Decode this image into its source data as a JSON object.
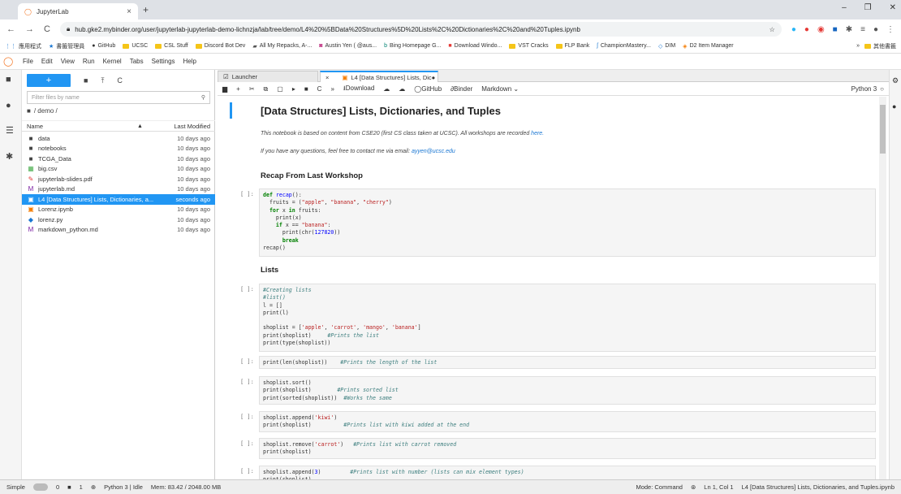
{
  "browser": {
    "tab_title": "JupyterLab",
    "url": "hub.gke2.mybinder.org/user/jupyterlab-jupyterlab-demo-lichnzja/lab/tree/demo/L4%20%5BData%20Structures%5D%20Lists%2C%20Dictionaries%2C%20and%20Tuples.ipynb",
    "bookmarks": [
      "應用程式",
      "書籤管理員",
      "GitHub",
      "UCSC",
      "CSL Stuff",
      "Discord Bot Dev",
      "All My Repacks, A-...",
      "Austin Yen ( @aus...",
      "Bing Homepage G...",
      "Download Windo...",
      "VST Cracks",
      "FLP Bank",
      "ChampionMastery...",
      "DIM",
      "D2 Item Manager"
    ],
    "bookmarks_other": "其他書籤"
  },
  "menu": [
    "File",
    "Edit",
    "View",
    "Run",
    "Kernel",
    "Tabs",
    "Settings",
    "Help"
  ],
  "filebrowser": {
    "filter_placeholder": "Filter files by name",
    "breadcrumb": "/ demo /",
    "col_name": "Name",
    "col_modified": "Last Modified",
    "files": [
      {
        "icon": "folder-icon",
        "glyph": "■",
        "name": "data",
        "modified": "10 days ago",
        "color": "#444"
      },
      {
        "icon": "folder-icon",
        "glyph": "■",
        "name": "notebooks",
        "modified": "10 days ago",
        "color": "#444"
      },
      {
        "icon": "folder-icon",
        "glyph": "■",
        "name": "TCGA_Data",
        "modified": "10 days ago",
        "color": "#444"
      },
      {
        "icon": "csv-icon",
        "glyph": "▦",
        "name": "big.csv",
        "modified": "10 days ago",
        "color": "#4caf50"
      },
      {
        "icon": "pdf-icon",
        "glyph": "✎",
        "name": "jupyterlab-slides.pdf",
        "modified": "10 days ago",
        "color": "#e53935"
      },
      {
        "icon": "markdown-icon",
        "glyph": "M",
        "name": "jupyterlab.md",
        "modified": "10 days ago",
        "color": "#7b1fa2"
      },
      {
        "icon": "notebook-icon",
        "glyph": "▣",
        "name": "L4 [Data Structures] Lists, Dictionaries, a...",
        "modified": "seconds ago",
        "color": "#fff",
        "selected": true
      },
      {
        "icon": "notebook-icon",
        "glyph": "▣",
        "name": "Lorenz.ipynb",
        "modified": "10 days ago",
        "color": "#f57c00"
      },
      {
        "icon": "python-icon",
        "glyph": "◆",
        "name": "lorenz.py",
        "modified": "10 days ago",
        "color": "#1976d2"
      },
      {
        "icon": "markdown-icon",
        "glyph": "M",
        "name": "markdown_python.md",
        "modified": "10 days ago",
        "color": "#7b1fa2"
      }
    ]
  },
  "dock": {
    "tab_launcher": "Launcher",
    "tab_notebook": "L4 [Data Structures] Lists, Dic●",
    "toolbar": {
      "download": "Download",
      "github": "GitHub",
      "binder": "Binder",
      "cell_type": "Markdown",
      "kernel": "Python 3"
    }
  },
  "notebook": {
    "title": "[Data Structures] Lists, Dictionaries, and Tuples",
    "intro_1": "This notebook is based on content from CSE20 (first CS class taken at UCSC). All workshops are recorded",
    "intro_1_link": "here.",
    "intro_2": "If you have any questions, feel free to contact me via email:",
    "intro_2_link": "ayyen@ucsc.edu",
    "h_recap": "Recap From Last Workshop",
    "h_lists": "Lists",
    "prompt": "[ ]:"
  },
  "status": {
    "mode": "Simple",
    "counts": "0",
    "terminals": "1",
    "kernel": "Python 3 | Idle",
    "mem": "Mem: 83.42 / 2048.00 MB",
    "cmd_mode": "Mode: Command",
    "pos": "Ln 1, Col 1",
    "file": "L4 [Data Structures] Lists, Dictionaries, and Tuples.ipynb"
  }
}
